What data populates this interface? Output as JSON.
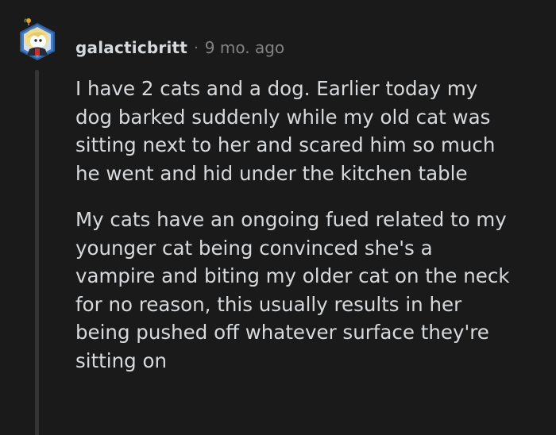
{
  "comment": {
    "username": "galacticbritt",
    "separator": "·",
    "timestamp": "9 mo. ago",
    "avatar": "snoo-avatar-icon",
    "paragraphs": [
      "I have 2 cats and a dog. Earlier today my\ndog barked suddenly while my old cat was\nsitting next to her and scared him so much\nhe went and hid under the kitchen table",
      "My cats have an ongoing fued related to my\nyounger cat being convinced she's a\nvampire and biting my older cat on the neck\nfor no reason, this usually results in her\nbeing pushed off whatever surface they're\nsitting on"
    ]
  },
  "colors": {
    "background": "#1a1a1b",
    "text": "#d7dadc",
    "muted": "#818384",
    "thread_line": "#343536"
  }
}
